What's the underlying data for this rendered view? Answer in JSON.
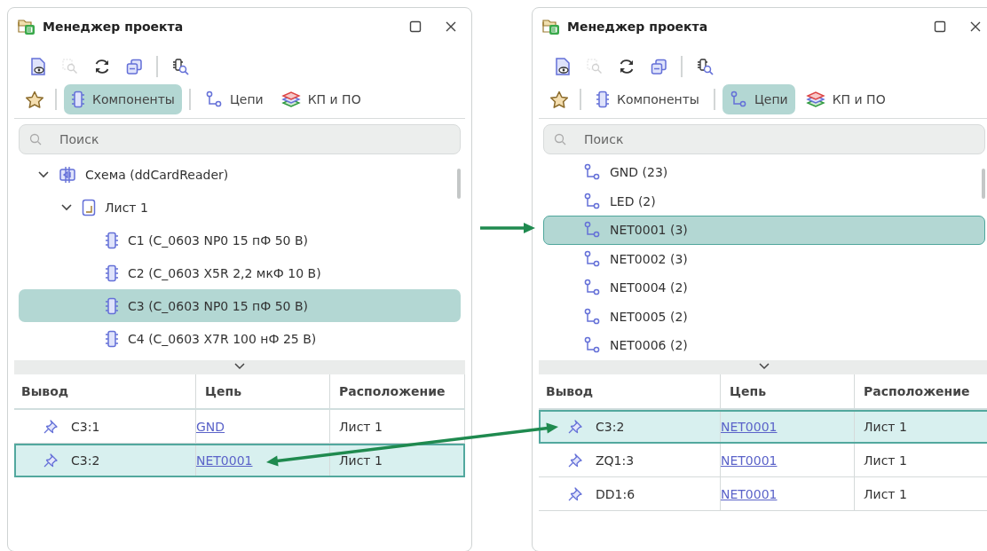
{
  "panels": [
    {
      "title": "Менеджер проекта",
      "toolbar": [
        {
          "kind": "preview",
          "disabled": false
        },
        {
          "kind": "zoom-select",
          "disabled": true
        },
        {
          "kind": "refresh",
          "disabled": false
        },
        {
          "kind": "collapse",
          "disabled": false
        },
        {
          "kind": "separator"
        },
        {
          "kind": "find-component",
          "disabled": false
        }
      ],
      "tabs": [
        {
          "kind": "favorites",
          "selected": false
        },
        {
          "kind": "components",
          "label": "Компоненты",
          "selected": true
        },
        {
          "kind": "nets",
          "label": "Цепи",
          "selected": false
        },
        {
          "kind": "layers",
          "label": "КП и ПО",
          "selected": false
        }
      ],
      "search": {
        "placeholder": "Поиск"
      },
      "tree": [
        {
          "kind": "schematic",
          "label": "Схема (ddCardReader)",
          "expanded": true,
          "selected": false,
          "children": [
            {
              "kind": "sheet",
              "label": "Лист 1",
              "expanded": true,
              "selected": false,
              "children": [
                {
                  "kind": "component",
                  "label": "C1 (C_0603 NP0 15 пФ 50 В)",
                  "selected": false
                },
                {
                  "kind": "component",
                  "label": "C2 (C_0603 X5R 2,2 мкФ 10 В)",
                  "selected": false
                },
                {
                  "kind": "component",
                  "label": "C3 (C_0603 NP0 15 пФ 50 В)",
                  "selected": true
                },
                {
                  "kind": "component",
                  "label": "C4 (C_0603 X7R 100 нФ 25 В)",
                  "selected": false
                }
              ]
            }
          ]
        }
      ],
      "table": {
        "columns": [
          "Вывод",
          "Цепь",
          "Расположение"
        ],
        "rows": [
          {
            "pin": "C3:1",
            "net": "GND",
            "location": "Лист 1",
            "selected": false
          },
          {
            "pin": "C3:2",
            "net": "NET0001",
            "location": "Лист 1",
            "selected": true
          }
        ]
      }
    },
    {
      "title": "Менеджер проекта",
      "toolbar": [
        {
          "kind": "preview",
          "disabled": false
        },
        {
          "kind": "zoom-select",
          "disabled": true
        },
        {
          "kind": "refresh",
          "disabled": false
        },
        {
          "kind": "collapse",
          "disabled": false
        },
        {
          "kind": "separator"
        },
        {
          "kind": "find-component",
          "disabled": false
        }
      ],
      "tabs": [
        {
          "kind": "favorites",
          "selected": false
        },
        {
          "kind": "components",
          "label": "Компоненты",
          "selected": false
        },
        {
          "kind": "nets",
          "label": "Цепи",
          "selected": true
        },
        {
          "kind": "layers",
          "label": "КП и ПО",
          "selected": false
        }
      ],
      "search": {
        "placeholder": "Поиск"
      },
      "tree": [
        {
          "kind": "net",
          "label": "GND (23)",
          "selected": false
        },
        {
          "kind": "net",
          "label": "LED (2)",
          "selected": false
        },
        {
          "kind": "net",
          "label": "NET0001 (3)",
          "selected": true
        },
        {
          "kind": "net",
          "label": "NET0002 (3)",
          "selected": false
        },
        {
          "kind": "net",
          "label": "NET0004 (2)",
          "selected": false
        },
        {
          "kind": "net",
          "label": "NET0005 (2)",
          "selected": false
        },
        {
          "kind": "net",
          "label": "NET0006 (2)",
          "selected": false
        }
      ],
      "table": {
        "columns": [
          "Вывод",
          "Цепь",
          "Расположение"
        ],
        "rows": [
          {
            "pin": "C3:2",
            "net": "NET0001",
            "location": "Лист 1",
            "selected": true
          },
          {
            "pin": "ZQ1:3",
            "net": "NET0001",
            "location": "Лист 1",
            "selected": false
          },
          {
            "pin": "DD1:6",
            "net": "NET0001",
            "location": "Лист 1",
            "selected": false
          }
        ]
      }
    }
  ],
  "arrows": [
    {
      "kind": "single"
    },
    {
      "kind": "double"
    }
  ]
}
